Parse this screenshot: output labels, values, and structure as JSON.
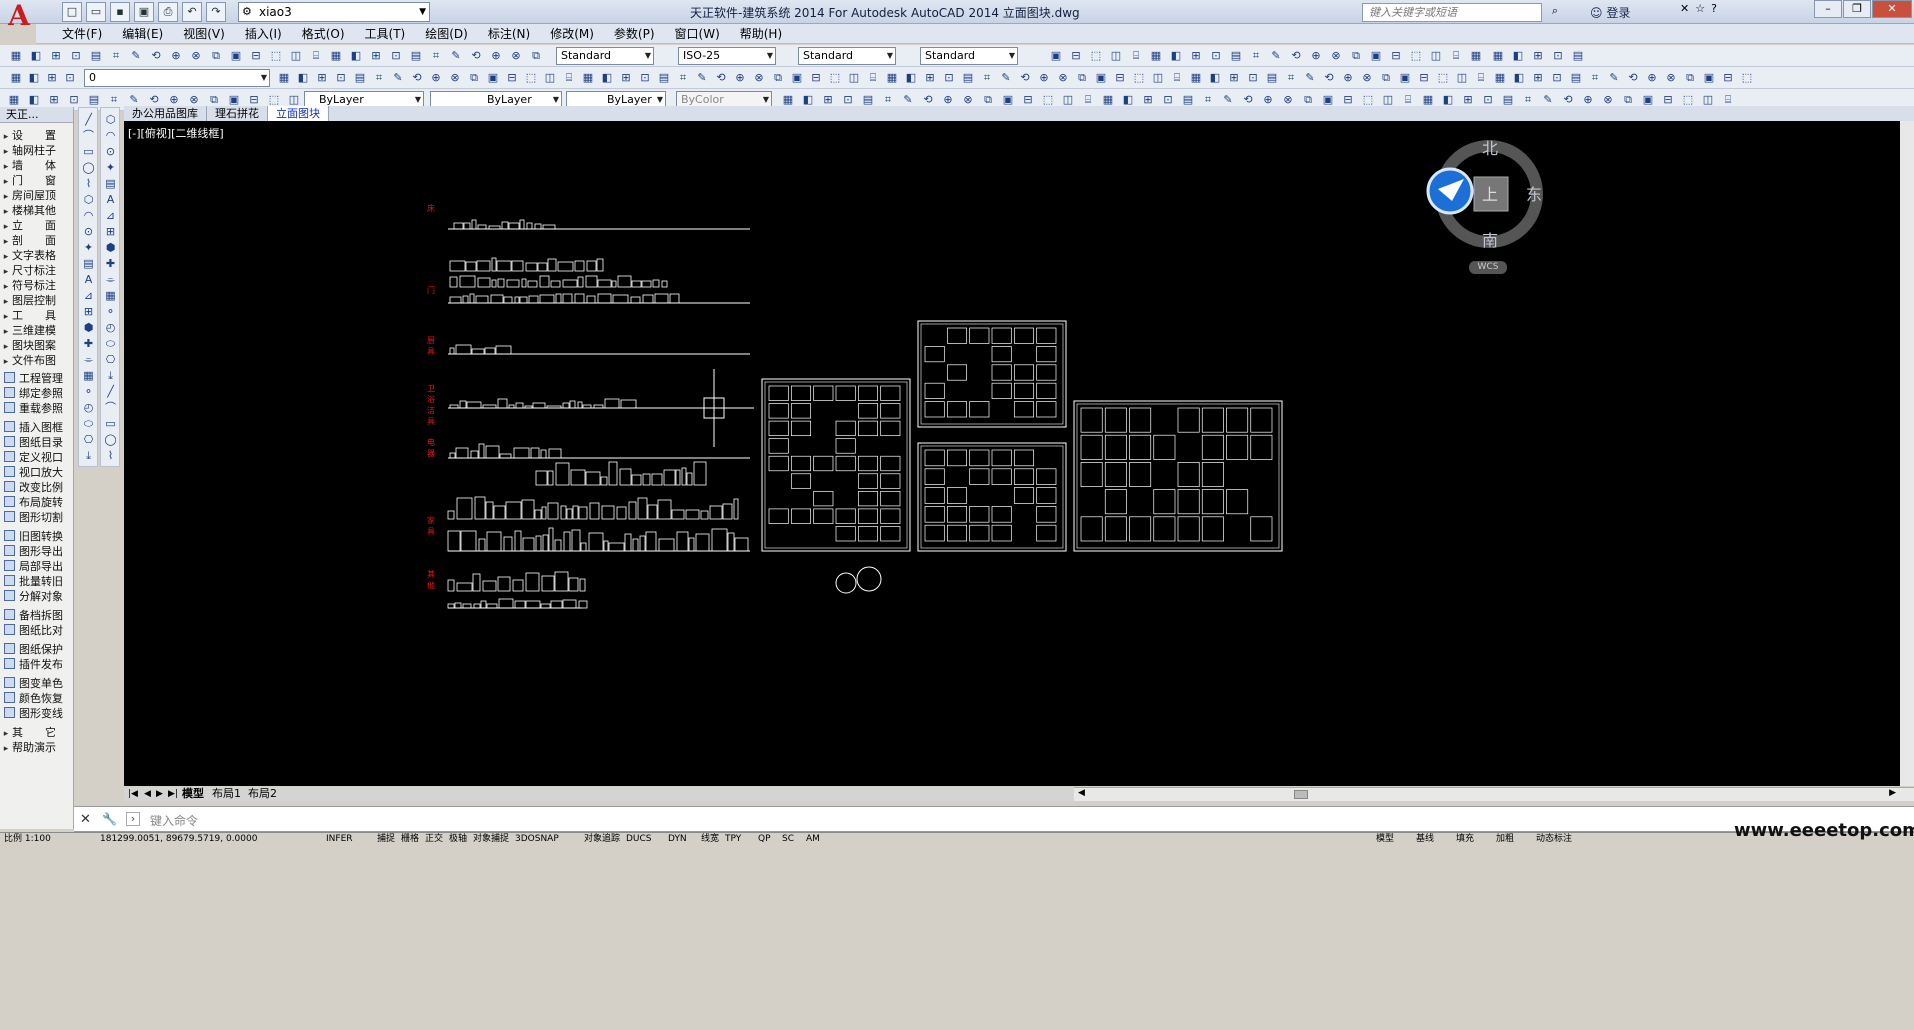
{
  "titlebar": {
    "app_logo": "A",
    "workspace": "xiao3",
    "window_title": "天正软件-建筑系统 2014  For Autodesk AutoCAD 2014    立面图块.dwg",
    "search_placeholder": "键入关键字或短语",
    "login": "登录"
  },
  "menu": [
    "文件(F)",
    "编辑(E)",
    "视图(V)",
    "插入(I)",
    "格式(O)",
    "工具(T)",
    "绘图(D)",
    "标注(N)",
    "修改(M)",
    "参数(P)",
    "窗口(W)",
    "帮助(H)"
  ],
  "toolbar": {
    "text_style": "Standard",
    "dim_style": "ISO-25",
    "table_style": "Standard",
    "mleader_style": "Standard",
    "layer": "0",
    "color": "ByLayer",
    "linetype": "ByLayer",
    "lineweight": "ByLayer",
    "plotstyle": "ByColor"
  },
  "left_panel": {
    "header": "天正...",
    "groups": [
      {
        "label": "设　　置",
        "arrow": true
      },
      {
        "label": "轴网柱子",
        "arrow": true
      },
      {
        "label": "墙　　体",
        "arrow": true
      },
      {
        "label": "门　　窗",
        "arrow": true
      },
      {
        "label": "房间屋顶",
        "arrow": true
      },
      {
        "label": "楼梯其他",
        "arrow": true
      },
      {
        "label": "立　　面",
        "arrow": true
      },
      {
        "label": "剖　　面",
        "arrow": true
      },
      {
        "label": "文字表格",
        "arrow": true
      },
      {
        "label": "尺寸标注",
        "arrow": true
      },
      {
        "label": "符号标注",
        "arrow": true
      },
      {
        "label": "图层控制",
        "arrow": true
      },
      {
        "label": "工　　具",
        "arrow": true
      },
      {
        "label": "三维建模",
        "arrow": true
      },
      {
        "label": "图块图案",
        "arrow": true
      },
      {
        "label": "文件布图",
        "arrow": true,
        "open": true
      }
    ],
    "items": [
      "工程管理",
      "绑定参照",
      "重载参照",
      "插入图框",
      "图纸目录",
      "定义视口",
      "视口放大",
      "改变比例",
      "布局旋转",
      "图形切割",
      "旧图转换",
      "图形导出",
      "局部导出",
      "批量转旧",
      "分解对象",
      "备档拆图",
      "图纸比对",
      "图纸保护",
      "插件发布",
      "图变单色",
      "颜色恢复",
      "图形变线"
    ],
    "tail": [
      {
        "label": "其　　它",
        "arrow": true
      },
      {
        "label": "帮助演示",
        "arrow": true
      }
    ]
  },
  "doc_tabs": [
    "办公用品图库",
    "理石拼花",
    "立面图块"
  ],
  "active_doc_tab": 2,
  "viewport_label": "[-][俯视][二维线框]",
  "viewcube": {
    "north": "北",
    "south": "南",
    "east": "东",
    "top": "上",
    "wcs": "WCS"
  },
  "drawing_labels": [
    "床",
    "门",
    "厨具",
    "卫浴洁具",
    "电器",
    "家具",
    "其他"
  ],
  "layout_tabs": [
    "模型",
    "布局1",
    "布局2"
  ],
  "command": {
    "placeholder": "键入命令"
  },
  "status": {
    "scale": "比例 1:100",
    "coords": "181299.0051, 89679.5719, 0.0000",
    "toggles": [
      "INFER",
      "捕捉",
      "栅格",
      "正交",
      "极轴",
      "对象捕捉",
      "3DOSNAP",
      "对象追踪",
      "DUCS",
      "DYN",
      "线宽",
      "TPY",
      "QP",
      "SC",
      "AM"
    ],
    "right": [
      "模型",
      "基线",
      "填充",
      "加粗",
      "动态标注"
    ]
  },
  "watermark": "www.eeeetop.com",
  "colors": {
    "canvas": "#000000",
    "label_red": "#e01818",
    "accent": "#1030c0"
  }
}
